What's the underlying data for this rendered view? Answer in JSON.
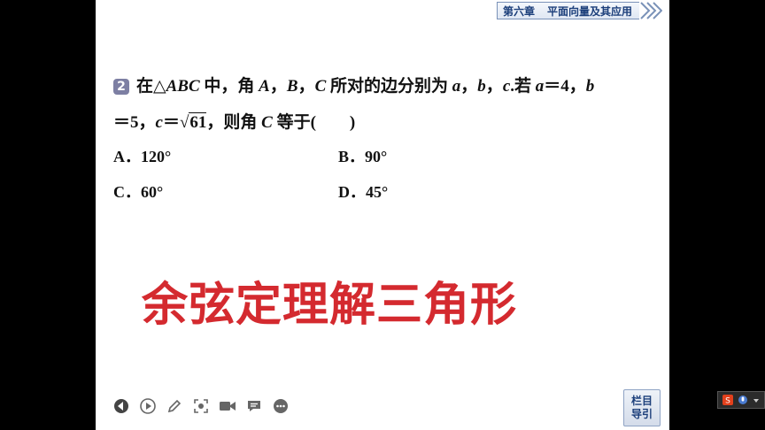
{
  "header": {
    "chapter": "第六章",
    "chapter_title": "平面向量及其应用"
  },
  "problem": {
    "number": "2",
    "line1": {
      "p1": "在△",
      "p2": "ABC",
      "p3": " 中，角 ",
      "p4": "A",
      "p5": "，",
      "p6": "B",
      "p7": "，",
      "p8": "C",
      "p9": " 所对的边分别为 ",
      "p10": "a",
      "p11": "，",
      "p12": "b",
      "p13": "，",
      "p14": "c",
      "p15": ".若 ",
      "p16": "a",
      "p17": "＝4，",
      "p18": "b"
    },
    "line2": {
      "p1": "＝5，",
      "p2": "c",
      "p3": "＝",
      "sqrt_symbol": "√",
      "sqrt_value": "61",
      "p4": "，则角 ",
      "p5": "C",
      "p6": " 等于(　　)"
    },
    "choices": {
      "A": "A．120°",
      "B": "B．90°",
      "C": "C．60°",
      "D": "D．45°"
    }
  },
  "overlay_title": "余弦定理解三角形",
  "toolbar": {
    "items": [
      "back-icon",
      "play-icon",
      "pen-icon",
      "screenshot-icon",
      "camera-icon",
      "comment-icon",
      "more-icon"
    ]
  },
  "nav_button": {
    "line1": "栏目",
    "line2": "导引"
  },
  "colors": {
    "accent": "#1b3e7a",
    "title_red": "#d42a2f",
    "badge": "#7d7fa3"
  }
}
